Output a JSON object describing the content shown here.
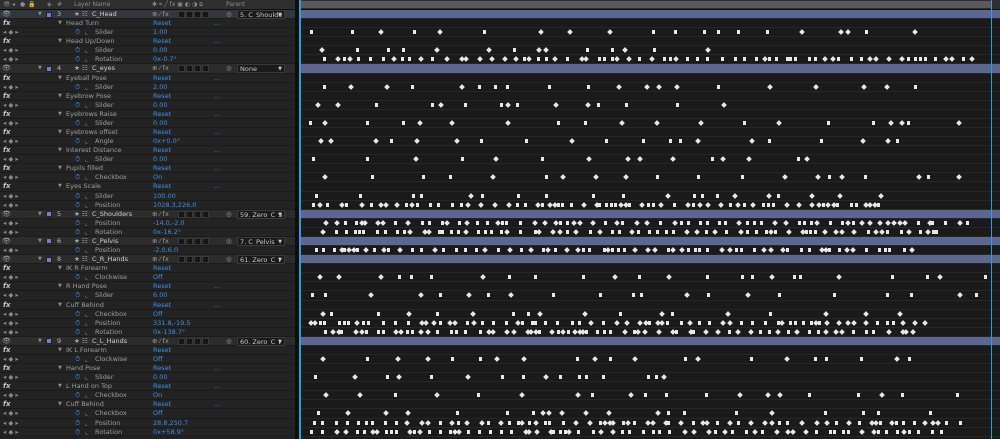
{
  "header": {
    "layer_name": "Layer Name",
    "parent": "Parent"
  },
  "rows": [
    {
      "kind": "layer",
      "num": "3",
      "name": "C_Head",
      "parent": "5. C_Shoulde",
      "sel": true
    },
    {
      "kind": "fx",
      "name": "Head Turn",
      "value": "Reset",
      "dots": "..."
    },
    {
      "kind": "prop",
      "name": "Slider",
      "value": "1.00"
    },
    {
      "kind": "fx",
      "name": "Head Up/Down",
      "value": "Reset",
      "dots": "..."
    },
    {
      "kind": "prop",
      "name": "Slider",
      "value": "0.00"
    },
    {
      "kind": "prop",
      "name": "Rotation",
      "value": "0x-0.7°"
    },
    {
      "kind": "layer",
      "num": "4",
      "name": "C_eyes",
      "parent": "None",
      "sel": false
    },
    {
      "kind": "fx",
      "name": "Eyeball Pose",
      "value": "Reset",
      "dots": "..."
    },
    {
      "kind": "prop",
      "name": "Slider",
      "value": "2.00"
    },
    {
      "kind": "fx",
      "name": "Eyebrow Pose",
      "value": "Reset",
      "dots": "..."
    },
    {
      "kind": "prop",
      "name": "Slider",
      "value": "0.00"
    },
    {
      "kind": "fx",
      "name": "Eyebrows Raise",
      "value": "Reset",
      "dots": "..."
    },
    {
      "kind": "prop",
      "name": "Slider",
      "value": "0.00"
    },
    {
      "kind": "fx",
      "name": "Eyebrows offset",
      "value": "Reset",
      "dots": "..."
    },
    {
      "kind": "prop",
      "name": "Angle",
      "value": "0x+0.0°"
    },
    {
      "kind": "fx",
      "name": "Interest Distance",
      "value": "Reset",
      "dots": "..."
    },
    {
      "kind": "prop",
      "name": "Slider",
      "value": "0.00"
    },
    {
      "kind": "fx",
      "name": "Pupils filled",
      "value": "Reset",
      "dots": "..."
    },
    {
      "kind": "prop",
      "name": "Checkbox",
      "value": "On"
    },
    {
      "kind": "fx",
      "name": "Eyes Scale",
      "value": "Reset",
      "dots": "..."
    },
    {
      "kind": "prop",
      "name": "Slider",
      "value": "100.00"
    },
    {
      "kind": "prop",
      "name": "Position",
      "value": "1028.3,226.0"
    },
    {
      "kind": "layer",
      "num": "5",
      "name": "C_Shoulders",
      "parent": "59. Zero_C_S",
      "sel": false
    },
    {
      "kind": "prop",
      "name": "Position",
      "value": "-14.0,-2.0"
    },
    {
      "kind": "prop",
      "name": "Rotation",
      "value": "0x-16.2°"
    },
    {
      "kind": "layer",
      "num": "6",
      "name": "C_Pelvis",
      "parent": "7. C_Pelvis",
      "sel": false
    },
    {
      "kind": "prop",
      "name": "Position",
      "value": "-2.0,6.0"
    },
    {
      "kind": "layer",
      "num": "8",
      "name": "C_R_Hands",
      "parent": "61. Zero_C_I",
      "sel": false
    },
    {
      "kind": "fx",
      "name": "IK R Forearm",
      "value": "Reset",
      "dots": ""
    },
    {
      "kind": "prop",
      "name": "Clockwise",
      "value": "Off"
    },
    {
      "kind": "fx",
      "name": "R Hand Pose",
      "value": "Reset",
      "dots": "..."
    },
    {
      "kind": "prop",
      "name": "Slider",
      "value": "6.00"
    },
    {
      "kind": "fx",
      "name": "Cuff Behind",
      "value": "Reset",
      "dots": "..."
    },
    {
      "kind": "prop",
      "name": "Checkbox",
      "value": "Off"
    },
    {
      "kind": "prop",
      "name": "Position",
      "value": "331.8,-19.5"
    },
    {
      "kind": "prop",
      "name": "Rotation",
      "value": "0x-138.7°"
    },
    {
      "kind": "layer",
      "num": "9",
      "name": "C_L_Hands",
      "parent": "60. Zero_C_I",
      "sel": false
    },
    {
      "kind": "fx",
      "name": "IK L Forearm",
      "value": "Reset",
      "dots": ""
    },
    {
      "kind": "prop",
      "name": "Clockwise",
      "value": "Off"
    },
    {
      "kind": "fx",
      "name": "Hand Pose",
      "value": "Reset",
      "dots": "..."
    },
    {
      "kind": "prop",
      "name": "Slider",
      "value": "0.00"
    },
    {
      "kind": "fx",
      "name": "L Hand on Top",
      "value": "Reset",
      "dots": "..."
    },
    {
      "kind": "prop",
      "name": "Checkbox",
      "value": "On"
    },
    {
      "kind": "fx",
      "name": "Cuff Behind",
      "value": "Reset",
      "dots": "..."
    },
    {
      "kind": "prop",
      "name": "Checkbox",
      "value": "Off"
    },
    {
      "kind": "prop",
      "name": "Position",
      "value": "28.8,250.7"
    },
    {
      "kind": "prop",
      "name": "Rotation",
      "value": "0x+58.9°"
    }
  ],
  "colors": {
    "layer_bar": "#5d6591",
    "label": "#6f7fd0",
    "value": "#3f8ee6",
    "time_indicator": "#2f9ed6"
  },
  "icons": {
    "eye": "eye-icon",
    "lock": "lock-icon",
    "solo": "solo-icon",
    "tag": "label-icon",
    "stopwatch": "stopwatch-icon",
    "graph": "graph-icon",
    "fx": "fx-icon",
    "pickwhip": "pickwhip-icon"
  }
}
